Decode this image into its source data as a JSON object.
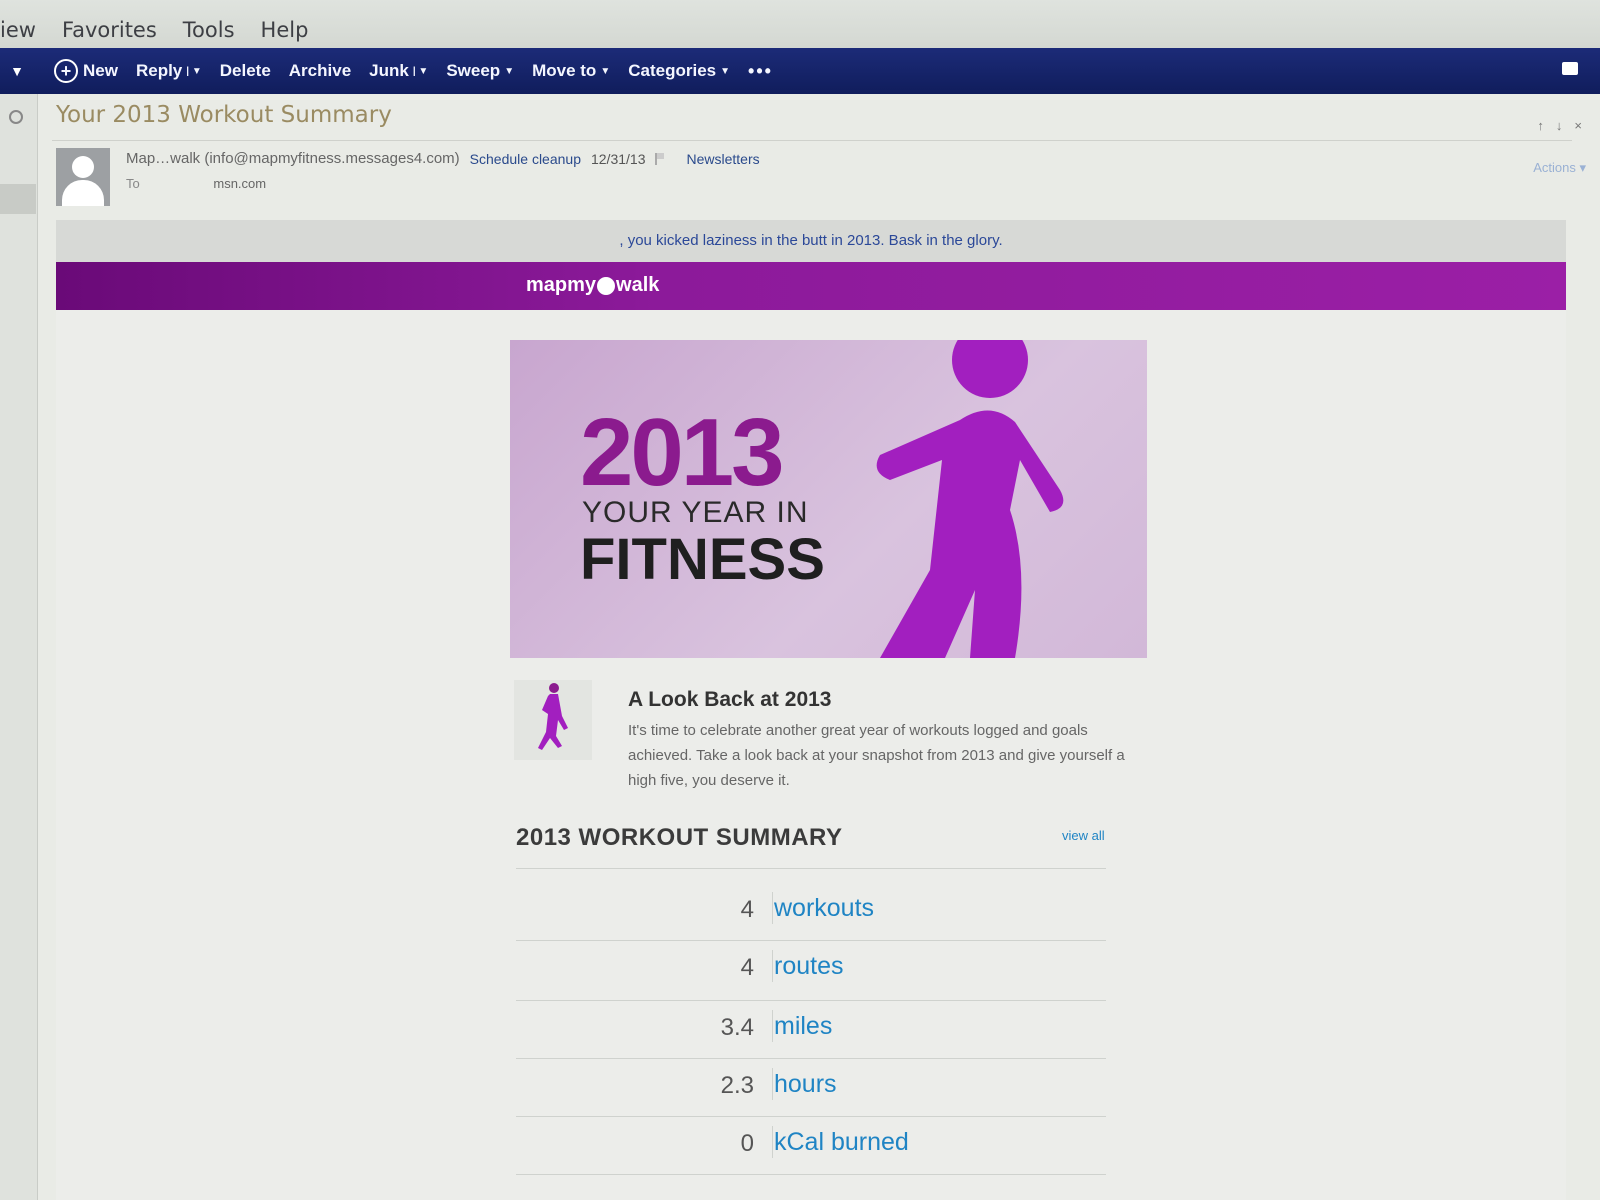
{
  "browser_menu": {
    "items": [
      "iew",
      "Favorites",
      "Tools",
      "Help"
    ]
  },
  "command_bar": {
    "new": "New",
    "reply": "Reply",
    "delete": "Delete",
    "archive": "Archive",
    "junk": "Junk",
    "sweep": "Sweep",
    "move_to": "Move to",
    "categories": "Categories",
    "more": "•••"
  },
  "message": {
    "subject": "Your 2013 Workout Summary",
    "from": "Map…walk (info@mapmyfitness.messages4.com)",
    "schedule_cleanup": "Schedule cleanup",
    "date": "12/31/13",
    "category": "Newsletters",
    "to_label": "To",
    "to_address": "msn.com",
    "actions": "Actions"
  },
  "email": {
    "preheader": ", you kicked laziness in the butt in 2013. Bask in the glory.",
    "logo_left": "mapmy",
    "logo_right": "walk",
    "hero": {
      "year": "2013",
      "line2": "YOUR YEAR IN",
      "line3": "FITNESS"
    },
    "look_back": {
      "title": "A Look Back at 2013",
      "text": "It's time to celebrate another great year of workouts logged and goals achieved. Take a look back at your snapshot from 2013 and give yourself a high five, you deserve it."
    },
    "summary": {
      "title": "2013 WORKOUT SUMMARY",
      "view_all": "view all",
      "stats": [
        {
          "value": "4",
          "label": "workouts"
        },
        {
          "value": "4",
          "label": "routes"
        },
        {
          "value": "3.4",
          "label": "miles"
        },
        {
          "value": "2.3",
          "label": "hours"
        },
        {
          "value": "0",
          "label": "kCal burned"
        }
      ]
    }
  },
  "colors": {
    "command_bar": "#15236a",
    "brand_purple": "#8c1a9a",
    "link_blue": "#1f84c4"
  }
}
